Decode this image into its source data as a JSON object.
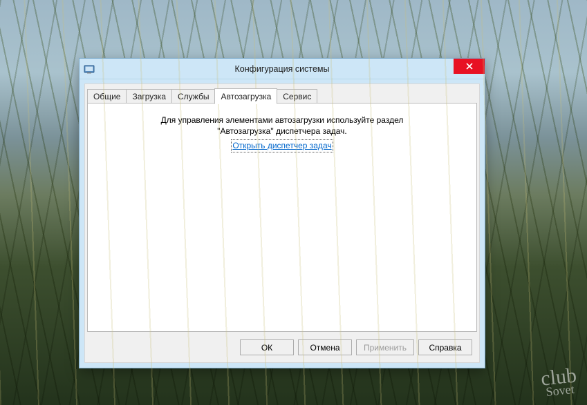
{
  "window": {
    "title": "Конфигурация системы"
  },
  "tabs": {
    "general": "Общие",
    "boot": "Загрузка",
    "services": "Службы",
    "startup": "Автозагрузка",
    "tools": "Сервис",
    "active": "startup"
  },
  "startup_page": {
    "message_line1": "Для управления элементами автозагрузки используйте раздел",
    "message_line2": "\"Автозагрузка\" диспетчера задач.",
    "link_text": "Открыть диспетчер задач"
  },
  "buttons": {
    "ok": "ОК",
    "cancel": "Отмена",
    "apply": "Применить",
    "help": "Справка",
    "apply_enabled": false
  },
  "watermark": {
    "top": "club",
    "bottom": "Sovet"
  }
}
